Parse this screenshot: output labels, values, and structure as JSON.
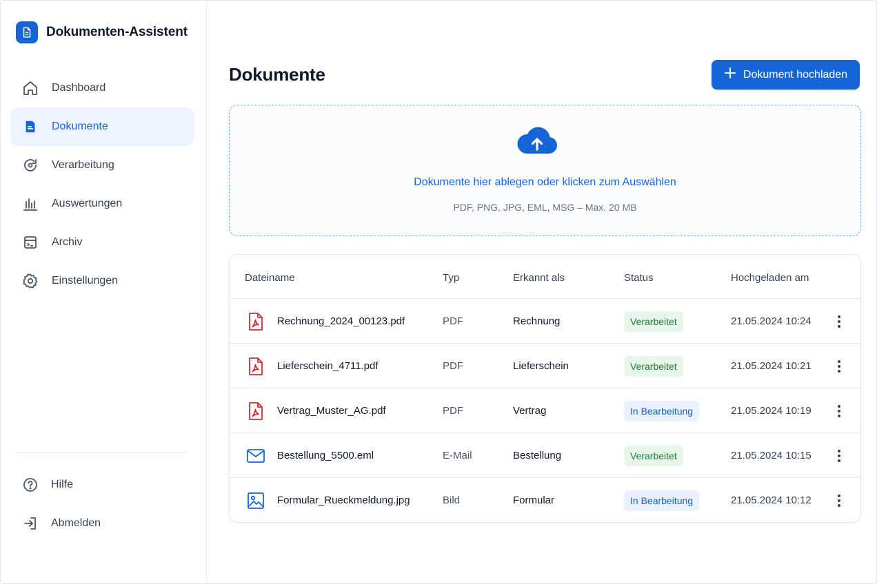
{
  "app": {
    "name": "Dokumenten-Assistent"
  },
  "nav": {
    "items": [
      {
        "label": "Dashboard",
        "icon": "home-icon",
        "active": false
      },
      {
        "label": "Dokumente",
        "icon": "document-icon",
        "active": true
      },
      {
        "label": "Verarbeitung",
        "icon": "refresh-icon",
        "active": false
      },
      {
        "label": "Auswertungen",
        "icon": "bar-chart-icon",
        "active": false
      },
      {
        "label": "Archiv",
        "icon": "archive-icon",
        "active": false
      },
      {
        "label": "Einstellungen",
        "icon": "gear-icon",
        "active": false
      }
    ],
    "bottom": [
      {
        "label": "Hilfe",
        "icon": "help-icon"
      },
      {
        "label": "Abmelden",
        "icon": "logout-icon"
      }
    ]
  },
  "main": {
    "title": "Dokumente",
    "upload_button": "Dokument hochladen"
  },
  "dropzone": {
    "text": "Dokumente hier ablegen oder klicken zum Auswählen",
    "hint": "PDF, PNG, JPG, EML, MSG – Max. 20 MB"
  },
  "table": {
    "headers": {
      "name": "Dateiname",
      "type": "Typ",
      "recognized": "Erkannt als",
      "status": "Status",
      "uploaded": "Hochgeladen am"
    },
    "rows": [
      {
        "icon": "pdf-file-icon",
        "name": "Rechnung_2024_00123.pdf",
        "type": "PDF",
        "recognized": "Rechnung",
        "status": "Verarbeitet",
        "status_kind": "done",
        "uploaded": "21.05.2024 10:24"
      },
      {
        "icon": "pdf-file-icon",
        "name": "Lieferschein_4711.pdf",
        "type": "PDF",
        "recognized": "Lieferschein",
        "status": "Verarbeitet",
        "status_kind": "done",
        "uploaded": "21.05.2024 10:21"
      },
      {
        "icon": "pdf-file-icon",
        "name": "Vertrag_Muster_AG.pdf",
        "type": "PDF",
        "recognized": "Vertrag",
        "status": "In Bearbeitung",
        "status_kind": "progress",
        "uploaded": "21.05.2024 10:19"
      },
      {
        "icon": "mail-icon",
        "name": "Bestellung_5500.eml",
        "type": "E-Mail",
        "recognized": "Bestellung",
        "status": "Verarbeitet",
        "status_kind": "done",
        "uploaded": "21.05.2024 10:15"
      },
      {
        "icon": "image-icon",
        "name": "Formular_Rueckmeldung.jpg",
        "type": "Bild",
        "recognized": "Formular",
        "status": "In Bearbeitung",
        "status_kind": "progress",
        "uploaded": "21.05.2024 10:12"
      }
    ]
  },
  "colors": {
    "accent": "#1565d8",
    "pdf_red": "#d32f2f",
    "status_done_bg": "#e6f6ea",
    "status_done_text": "#1f7a3a",
    "status_progress_bg": "#e8f1fd",
    "status_progress_text": "#1a5fc0"
  }
}
